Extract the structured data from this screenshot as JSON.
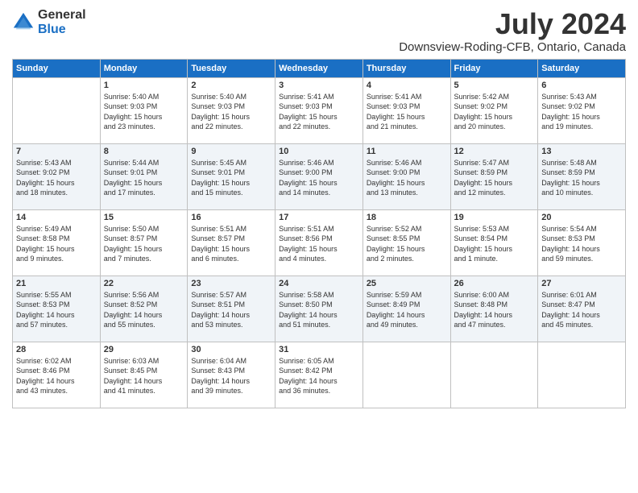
{
  "logo": {
    "text_general": "General",
    "text_blue": "Blue"
  },
  "header": {
    "month_year": "July 2024",
    "location": "Downsview-Roding-CFB, Ontario, Canada"
  },
  "days_of_week": [
    "Sunday",
    "Monday",
    "Tuesday",
    "Wednesday",
    "Thursday",
    "Friday",
    "Saturday"
  ],
  "weeks": [
    [
      {
        "day": "",
        "info": ""
      },
      {
        "day": "1",
        "info": "Sunrise: 5:40 AM\nSunset: 9:03 PM\nDaylight: 15 hours\nand 23 minutes."
      },
      {
        "day": "2",
        "info": "Sunrise: 5:40 AM\nSunset: 9:03 PM\nDaylight: 15 hours\nand 22 minutes."
      },
      {
        "day": "3",
        "info": "Sunrise: 5:41 AM\nSunset: 9:03 PM\nDaylight: 15 hours\nand 22 minutes."
      },
      {
        "day": "4",
        "info": "Sunrise: 5:41 AM\nSunset: 9:03 PM\nDaylight: 15 hours\nand 21 minutes."
      },
      {
        "day": "5",
        "info": "Sunrise: 5:42 AM\nSunset: 9:02 PM\nDaylight: 15 hours\nand 20 minutes."
      },
      {
        "day": "6",
        "info": "Sunrise: 5:43 AM\nSunset: 9:02 PM\nDaylight: 15 hours\nand 19 minutes."
      }
    ],
    [
      {
        "day": "7",
        "info": "Sunrise: 5:43 AM\nSunset: 9:02 PM\nDaylight: 15 hours\nand 18 minutes."
      },
      {
        "day": "8",
        "info": "Sunrise: 5:44 AM\nSunset: 9:01 PM\nDaylight: 15 hours\nand 17 minutes."
      },
      {
        "day": "9",
        "info": "Sunrise: 5:45 AM\nSunset: 9:01 PM\nDaylight: 15 hours\nand 15 minutes."
      },
      {
        "day": "10",
        "info": "Sunrise: 5:46 AM\nSunset: 9:00 PM\nDaylight: 15 hours\nand 14 minutes."
      },
      {
        "day": "11",
        "info": "Sunrise: 5:46 AM\nSunset: 9:00 PM\nDaylight: 15 hours\nand 13 minutes."
      },
      {
        "day": "12",
        "info": "Sunrise: 5:47 AM\nSunset: 8:59 PM\nDaylight: 15 hours\nand 12 minutes."
      },
      {
        "day": "13",
        "info": "Sunrise: 5:48 AM\nSunset: 8:59 PM\nDaylight: 15 hours\nand 10 minutes."
      }
    ],
    [
      {
        "day": "14",
        "info": "Sunrise: 5:49 AM\nSunset: 8:58 PM\nDaylight: 15 hours\nand 9 minutes."
      },
      {
        "day": "15",
        "info": "Sunrise: 5:50 AM\nSunset: 8:57 PM\nDaylight: 15 hours\nand 7 minutes."
      },
      {
        "day": "16",
        "info": "Sunrise: 5:51 AM\nSunset: 8:57 PM\nDaylight: 15 hours\nand 6 minutes."
      },
      {
        "day": "17",
        "info": "Sunrise: 5:51 AM\nSunset: 8:56 PM\nDaylight: 15 hours\nand 4 minutes."
      },
      {
        "day": "18",
        "info": "Sunrise: 5:52 AM\nSunset: 8:55 PM\nDaylight: 15 hours\nand 2 minutes."
      },
      {
        "day": "19",
        "info": "Sunrise: 5:53 AM\nSunset: 8:54 PM\nDaylight: 15 hours\nand 1 minute."
      },
      {
        "day": "20",
        "info": "Sunrise: 5:54 AM\nSunset: 8:53 PM\nDaylight: 14 hours\nand 59 minutes."
      }
    ],
    [
      {
        "day": "21",
        "info": "Sunrise: 5:55 AM\nSunset: 8:53 PM\nDaylight: 14 hours\nand 57 minutes."
      },
      {
        "day": "22",
        "info": "Sunrise: 5:56 AM\nSunset: 8:52 PM\nDaylight: 14 hours\nand 55 minutes."
      },
      {
        "day": "23",
        "info": "Sunrise: 5:57 AM\nSunset: 8:51 PM\nDaylight: 14 hours\nand 53 minutes."
      },
      {
        "day": "24",
        "info": "Sunrise: 5:58 AM\nSunset: 8:50 PM\nDaylight: 14 hours\nand 51 minutes."
      },
      {
        "day": "25",
        "info": "Sunrise: 5:59 AM\nSunset: 8:49 PM\nDaylight: 14 hours\nand 49 minutes."
      },
      {
        "day": "26",
        "info": "Sunrise: 6:00 AM\nSunset: 8:48 PM\nDaylight: 14 hours\nand 47 minutes."
      },
      {
        "day": "27",
        "info": "Sunrise: 6:01 AM\nSunset: 8:47 PM\nDaylight: 14 hours\nand 45 minutes."
      }
    ],
    [
      {
        "day": "28",
        "info": "Sunrise: 6:02 AM\nSunset: 8:46 PM\nDaylight: 14 hours\nand 43 minutes."
      },
      {
        "day": "29",
        "info": "Sunrise: 6:03 AM\nSunset: 8:45 PM\nDaylight: 14 hours\nand 41 minutes."
      },
      {
        "day": "30",
        "info": "Sunrise: 6:04 AM\nSunset: 8:43 PM\nDaylight: 14 hours\nand 39 minutes."
      },
      {
        "day": "31",
        "info": "Sunrise: 6:05 AM\nSunset: 8:42 PM\nDaylight: 14 hours\nand 36 minutes."
      },
      {
        "day": "",
        "info": ""
      },
      {
        "day": "",
        "info": ""
      },
      {
        "day": "",
        "info": ""
      }
    ]
  ]
}
